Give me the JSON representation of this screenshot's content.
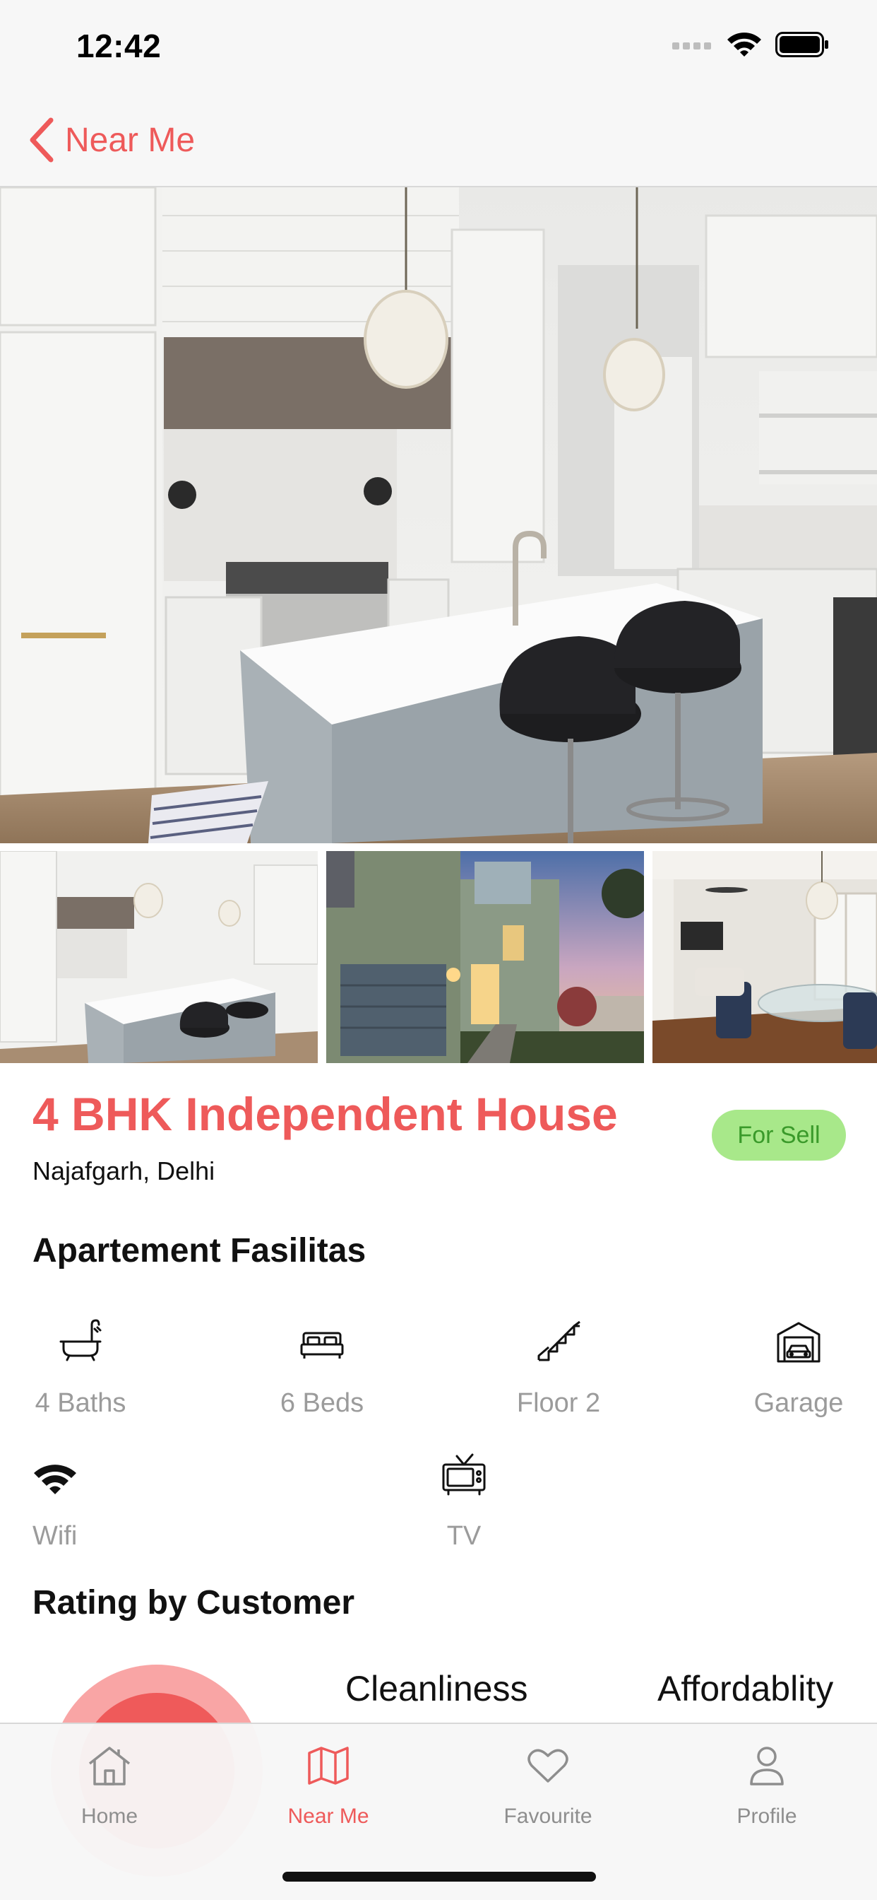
{
  "status_bar": {
    "time": "12:42"
  },
  "nav": {
    "back_label": "Near Me"
  },
  "property": {
    "title": "4 BHK Independent House",
    "location": "Najafgarh, Delhi",
    "badge": "For Sell"
  },
  "facilities": {
    "section_title": "Apartement Fasilitas",
    "items": [
      {
        "icon": "bathtub-icon",
        "label": "4 Baths"
      },
      {
        "icon": "bed-icon",
        "label": "6 Beds"
      },
      {
        "icon": "stairs-icon",
        "label": "Floor 2"
      },
      {
        "icon": "garage-icon",
        "label": "Garage"
      },
      {
        "icon": "wifi-icon",
        "label": "Wifi"
      },
      {
        "icon": "tv-icon",
        "label": "TV"
      }
    ]
  },
  "rating": {
    "section_title": "Rating by Customer",
    "headers": [
      "Cleanliness",
      "Affordablity"
    ]
  },
  "tab_bar": {
    "active": "Near Me",
    "tabs": [
      {
        "icon": "home-icon",
        "label": "Home"
      },
      {
        "icon": "map-icon",
        "label": "Near Me"
      },
      {
        "icon": "heart-icon",
        "label": "Favourite"
      },
      {
        "icon": "person-icon",
        "label": "Profile"
      }
    ]
  },
  "colors": {
    "accent": "#ee5a5a",
    "badge_bg": "#a8e88a",
    "badge_text": "#3a9a2a",
    "muted_text": "#9b9b9b"
  }
}
